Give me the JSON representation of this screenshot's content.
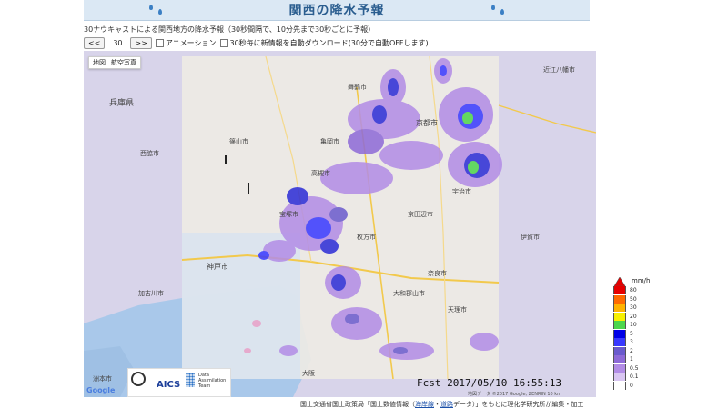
{
  "header": {
    "title": "関西の降水予報"
  },
  "description": "30ナウキャストによる関西地方の降水予報（30秒間隔で、10分先まで30秒ごとに予報）",
  "controls": {
    "prev_label": "<<",
    "step_value": "30",
    "next_label": ">>",
    "animation_label": "アニメーション",
    "autodownload_label": "30秒毎に新情報を自動ダウンロード(30分で自動OFFします)"
  },
  "map": {
    "type_buttons": [
      "地図",
      "航空写真"
    ],
    "places": [
      "兵庫県",
      "神戸市",
      "京都市",
      "奈良市",
      "大阪",
      "大和郡山市",
      "京田辺市",
      "伊賀市",
      "宇治市",
      "高槻市",
      "舞鶴市",
      "近江八幡市",
      "洲本市",
      "西脇市",
      "篠山市",
      "亀岡市",
      "天理市",
      "枚方市",
      "宝塚市",
      "加古川市"
    ],
    "attribution": "地図データ ©2017 Google, ZENRIN 10 km",
    "google_logo": "Google"
  },
  "forecast_time": "Fcst 2017/05/10 16:55:13",
  "legend": {
    "unit": "mm/h",
    "levels": [
      {
        "label": "80",
        "color": "#e60000"
      },
      {
        "label": "50",
        "color": "#ff6a00"
      },
      {
        "label": "30",
        "color": "#ffb300"
      },
      {
        "label": "20",
        "color": "#f7f000"
      },
      {
        "label": "10",
        "color": "#4cd64c"
      },
      {
        "label": "5",
        "color": "#0000e6"
      },
      {
        "label": "3",
        "color": "#3838ff"
      },
      {
        "label": "2",
        "color": "#6a5acd"
      },
      {
        "label": "1",
        "color": "#8e6ad8"
      },
      {
        "label": "0.5",
        "color": "#b28ce6"
      },
      {
        "label": "0.1",
        "color": "#d9c6f2"
      },
      {
        "label": "0",
        "color": "#ffffff"
      }
    ]
  },
  "logos": {
    "aics": "AICS",
    "data_assimilation": [
      "Data",
      "Assimilation",
      "Team"
    ]
  },
  "credit": {
    "prefix": "国土交通省国土政策局「国土数値情報（",
    "link1": "海岸線",
    "sep": "・",
    "link2": "道路",
    "suffix": "データ）」をもとに理化学研究所が編集・加工"
  }
}
